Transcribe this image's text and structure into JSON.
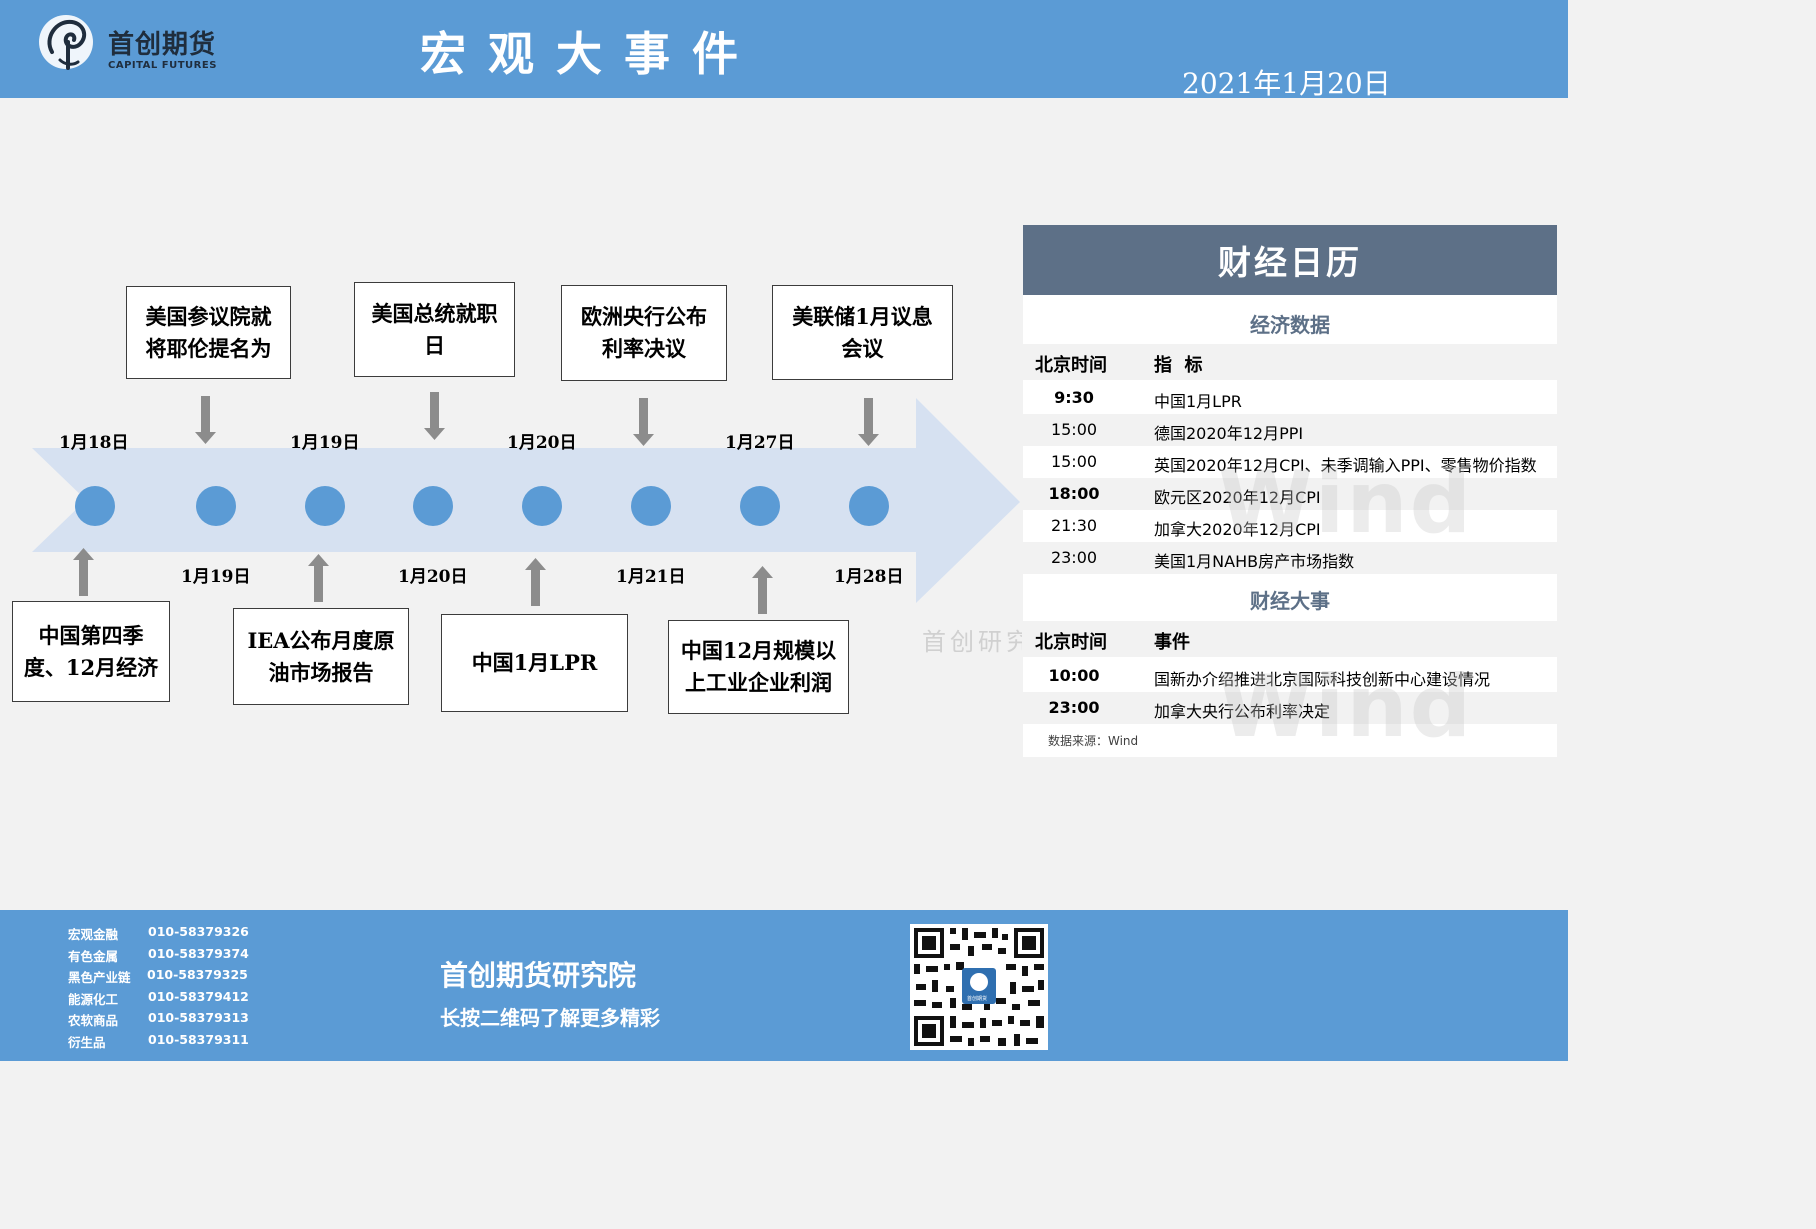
{
  "header": {
    "brand_cn": "首创期货",
    "brand_en": "CAPITAL FUTURES",
    "title": "宏观大事件",
    "date": "2021年1月20日"
  },
  "timeline": {
    "top_dates": [
      "1月18日",
      "1月19日",
      "1月20日",
      "1月27日"
    ],
    "bottom_dates": [
      "1月19日",
      "1月20日",
      "1月21日",
      "1月28日"
    ],
    "top_events": [
      "美国参议院就将耶伦提名为",
      "美国总统就职日",
      "欧洲央行公布利率决议",
      "美联储1月议息会议"
    ],
    "bottom_events": [
      "中国第四季度、12月经济",
      "IEA公布月度原油市场报告",
      "中国1月LPR",
      "中国12月规模以上工业企业利润"
    ],
    "colors": {
      "arrow": "#d6e1f1",
      "node": "#5b9bd5",
      "pointer": "#8c8c8c"
    }
  },
  "calendar": {
    "title": "财经日历",
    "data_section": "经济数据",
    "col_time": "北京时间",
    "col_indicator": "指  标",
    "data_rows": [
      {
        "time": "9:30",
        "item": "中国1月LPR"
      },
      {
        "time": "15:00",
        "item": "德国2020年12月PPI"
      },
      {
        "time": "15:00",
        "item": "英国2020年12月CPI、未季调输入PPI、零售物价指数"
      },
      {
        "time": "18:00",
        "item": "欧元区2020年12月CPI"
      },
      {
        "time": "21:30",
        "item": "加拿大2020年12月CPI"
      },
      {
        "time": "23:00",
        "item": "美国1月NAHB房产市场指数"
      }
    ],
    "events_section": "财经大事",
    "col_event": "事件",
    "event_rows": [
      {
        "time": "10:00",
        "item": "国新办介绍推进北京国际科技创新中心建设情况"
      },
      {
        "time": "23:00",
        "item": "加拿大央行公布利率决定"
      }
    ],
    "source": "数据来源：Wind",
    "watermark": "Wind",
    "colors": {
      "head": "#5d7087",
      "stripe": "#f2f2f2"
    }
  },
  "watermark_text": "首创研究",
  "footer": {
    "contacts": [
      {
        "dept": "宏观金融",
        "phone": "010-58379326"
      },
      {
        "dept": "有色金属",
        "phone": "010-58379374"
      },
      {
        "dept": "黑色产业链",
        "phone": "010-58379325"
      },
      {
        "dept": "能源化工",
        "phone": "010-58379412"
      },
      {
        "dept": "农软商品",
        "phone": "010-58379313"
      },
      {
        "dept": "衍生品",
        "phone": "010-58379311"
      }
    ],
    "org": "首创期货研究院",
    "qr_tip": "长按二维码了解更多精彩",
    "qr_label": "首创期货",
    "colors": {
      "band": "#5b9bd5"
    }
  }
}
